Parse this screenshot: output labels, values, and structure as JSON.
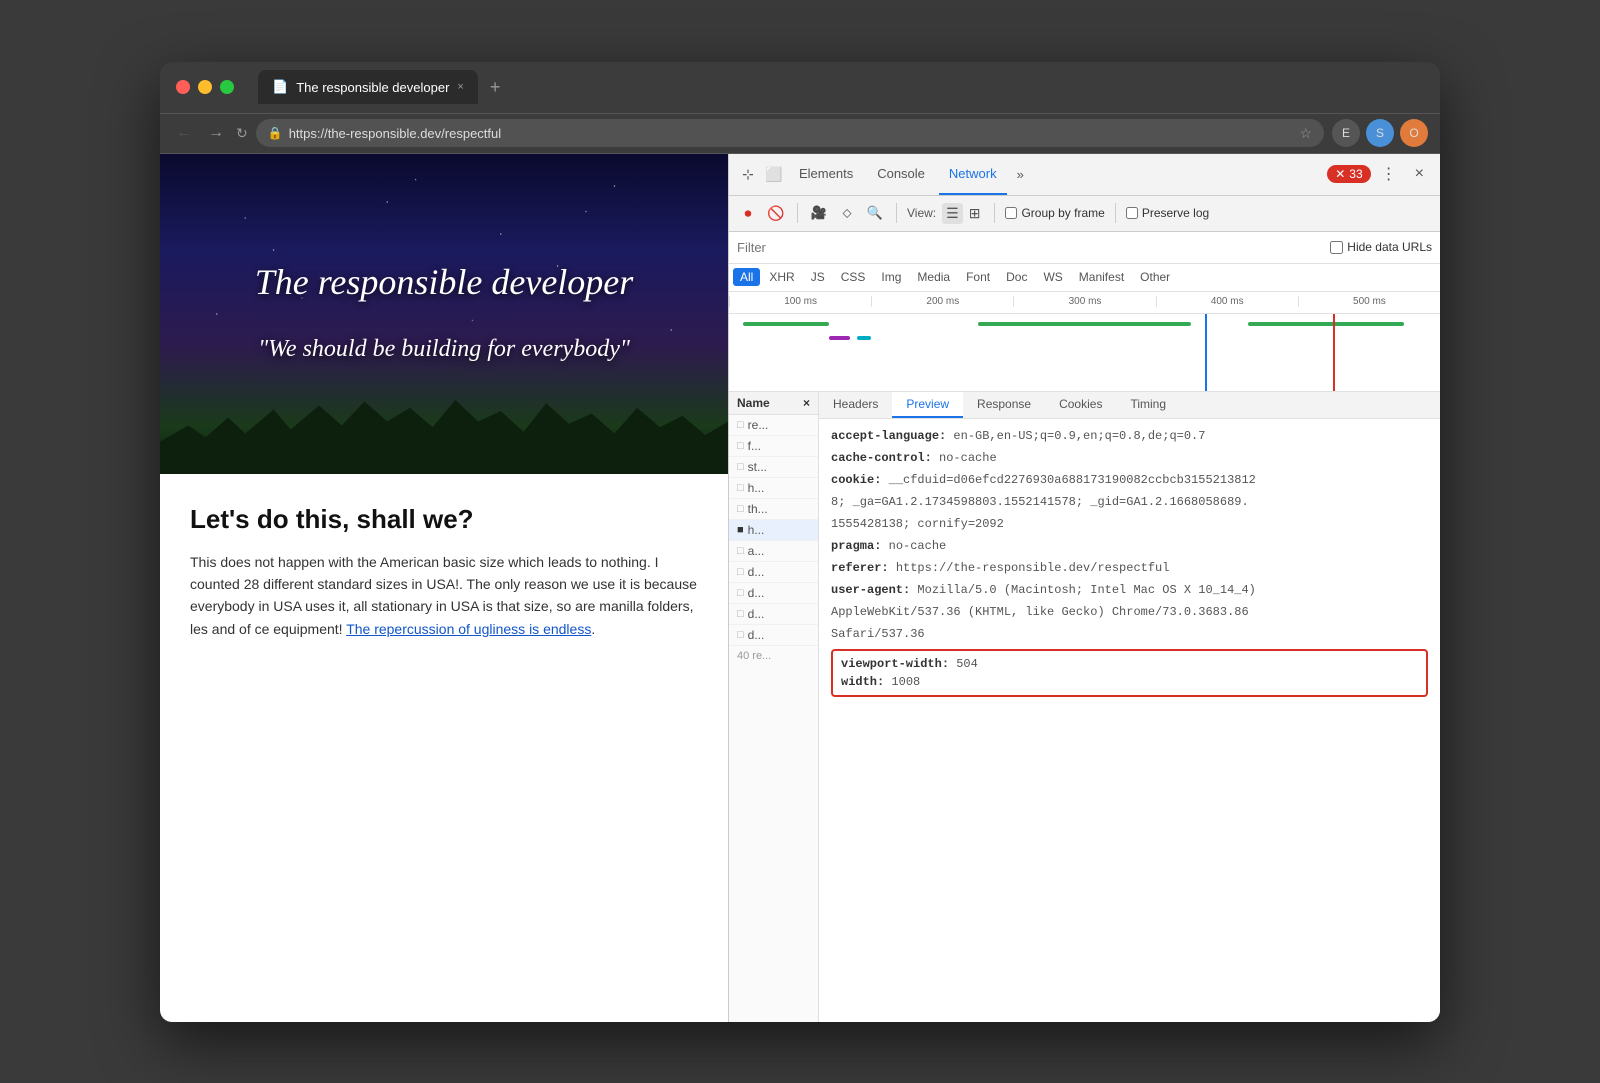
{
  "browser": {
    "tab_title": "The responsible developer",
    "url": "https://the-responsible.dev/respectful",
    "new_tab_label": "+"
  },
  "webpage": {
    "hero_title": "The responsible developer",
    "hero_quote": "\"We should be building for everybody\"",
    "content_heading": "Let's do this, shall we?",
    "content_body": "This does not happen with the American basic size which leads to nothing. I counted 28 different standard sizes in USA!. The only reason we use it is because everybody in USA uses it, all stationary in USA is that size, so are manilla folders, les and of ce equipment!",
    "content_link": "The repercussion of ugliness is endless"
  },
  "devtools": {
    "tabs": [
      {
        "label": "Elements",
        "active": false
      },
      {
        "label": "Console",
        "active": false
      },
      {
        "label": "Network",
        "active": true
      },
      {
        "label": "»",
        "active": false
      }
    ],
    "error_count": "33",
    "close_label": "×"
  },
  "network": {
    "filter_placeholder": "Filter",
    "hide_data_urls_label": "Hide data URLs",
    "view_label": "View:",
    "group_by_frame_label": "Group by frame",
    "preserve_log_label": "Preserve log",
    "type_filters": [
      "All",
      "XHR",
      "JS",
      "CSS",
      "Img",
      "Media",
      "Font",
      "Doc",
      "WS",
      "Manifest",
      "Other"
    ],
    "active_filter": "All",
    "timeline_ticks": [
      "100 ms",
      "200 ms",
      "300 ms",
      "400 ms",
      "500 ms"
    ],
    "files": [
      "re...",
      "f...",
      "st...",
      "h...",
      "th...",
      "h...",
      "a...",
      "d...",
      "d...",
      "d...",
      "d..."
    ],
    "file_count": "40 re...",
    "headers_tabs": [
      "Name",
      "×",
      "Headers",
      "Preview",
      "Response",
      "Cookies",
      "Timing"
    ],
    "active_header_tab": "Headers",
    "headers": [
      {
        "key": "accept-language:",
        "value": "en-GB,en-US;q=0.9,en;q=0.8,de;q=0.7",
        "truncated": true
      },
      {
        "key": "cache-control:",
        "value": "no-cache"
      },
      {
        "key": "cookie:",
        "value": "__cfduid=d06efcd2276930a688173190082ccbcb3155213812",
        "extra": "8; _ga=GA1.2.1734598803.1552141578; _gid=GA1.2.1668058689. 1555428138; cornify=2092",
        "truncated": true
      },
      {
        "key": "pragma:",
        "value": "no-cache"
      },
      {
        "key": "referer:",
        "value": "https://the-responsible.dev/respectful"
      },
      {
        "key": "user-agent:",
        "value": "Mozilla/5.0 (Macintosh; Intel Mac OS X 10_14_4) AppleWebKit/537.36 (KHTML, like Gecko) Chrome/73.0.3683.86 Safari/537.36",
        "truncated": true
      },
      {
        "key": "viewport-width:",
        "value": "504",
        "highlighted": true
      },
      {
        "key": "width:",
        "value": "1008",
        "highlighted": true
      }
    ]
  }
}
